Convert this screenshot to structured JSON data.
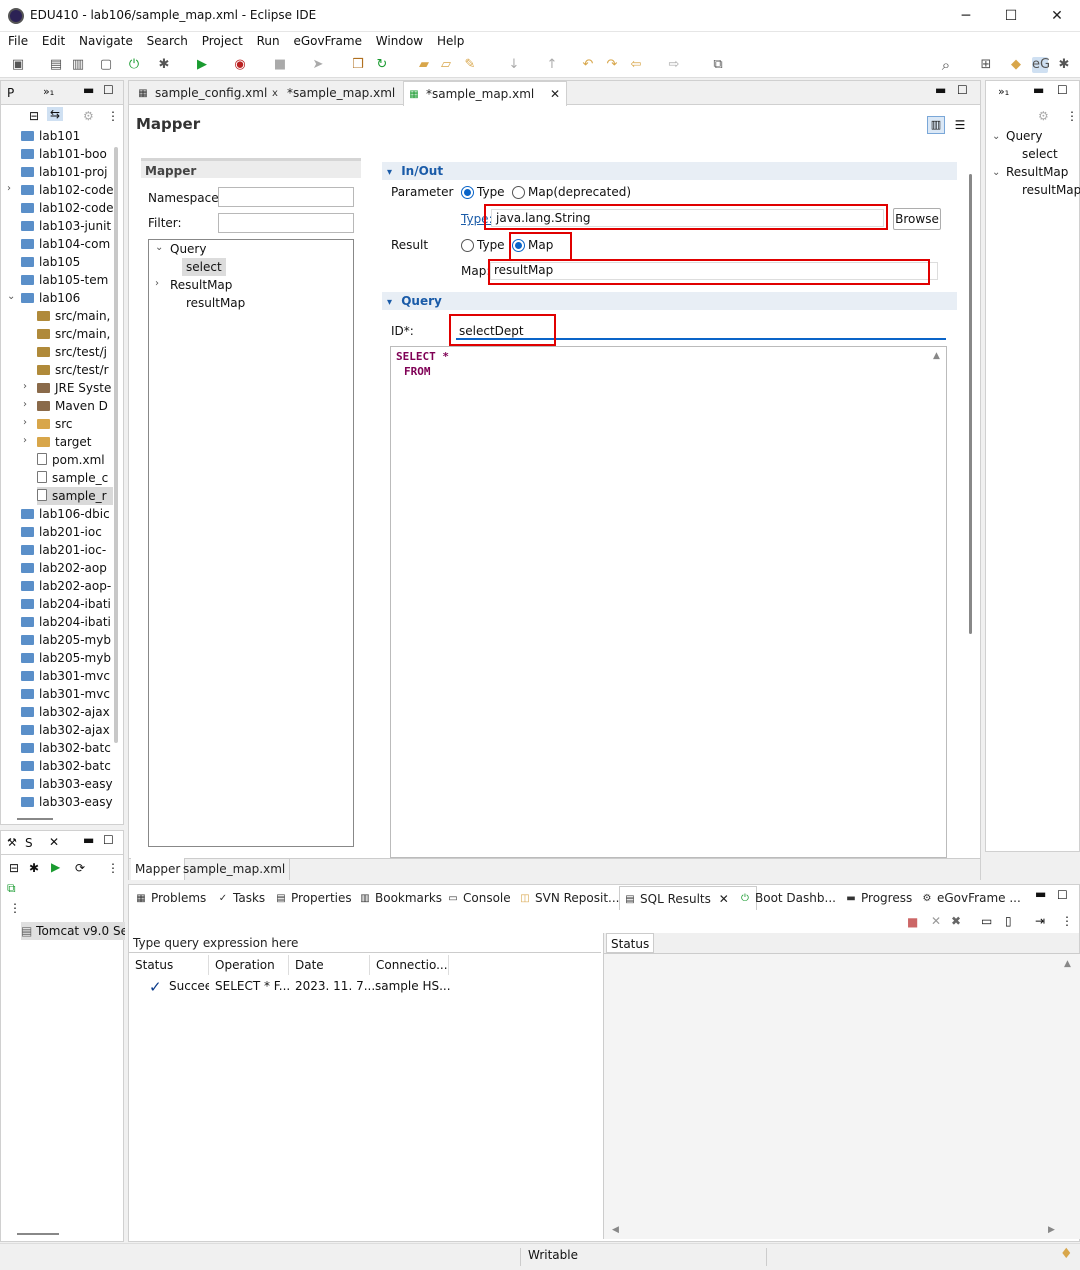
{
  "window": {
    "title": "EDU410 - lab106/sample_map.xml - Eclipse IDE",
    "minimize": "─",
    "maximize": "☐",
    "close": "✕"
  },
  "menu": [
    "File",
    "Edit",
    "Navigate",
    "Search",
    "Project",
    "Run",
    "eGovFrame",
    "Window",
    "Help"
  ],
  "left_panel": {
    "tab_label": "P",
    "overflow": "»₁",
    "items": [
      {
        "label": "lab101",
        "depth": 0,
        "icon": "folder"
      },
      {
        "label": "lab101-boo",
        "depth": 0,
        "icon": "folder"
      },
      {
        "label": "lab101-proj",
        "depth": 0,
        "icon": "folder"
      },
      {
        "label": "lab102-code",
        "depth": 0,
        "icon": "maven-folder",
        "expand": "›"
      },
      {
        "label": "lab102-code",
        "depth": 0,
        "icon": "folder"
      },
      {
        "label": "lab103-junit",
        "depth": 0,
        "icon": "folder"
      },
      {
        "label": "lab104-com",
        "depth": 0,
        "icon": "folder"
      },
      {
        "label": "lab105",
        "depth": 0,
        "icon": "folder"
      },
      {
        "label": "lab105-tem",
        "depth": 0,
        "icon": "folder"
      },
      {
        "label": "lab106",
        "depth": 0,
        "icon": "maven-folder",
        "expand": "⌄"
      },
      {
        "label": "src/main,",
        "depth": 1,
        "icon": "package"
      },
      {
        "label": "src/main,",
        "depth": 1,
        "icon": "package"
      },
      {
        "label": "src/test/j",
        "depth": 1,
        "icon": "package"
      },
      {
        "label": "src/test/r",
        "depth": 1,
        "icon": "package"
      },
      {
        "label": "JRE Syste",
        "depth": 1,
        "icon": "library",
        "expand": "›"
      },
      {
        "label": "Maven D",
        "depth": 1,
        "icon": "library",
        "expand": "›"
      },
      {
        "label": "src",
        "depth": 1,
        "icon": "yfolder",
        "expand": "›"
      },
      {
        "label": "target",
        "depth": 1,
        "icon": "yfolder",
        "expand": "›"
      },
      {
        "label": "pom.xml",
        "depth": 1,
        "icon": "file"
      },
      {
        "label": "sample_c",
        "depth": 1,
        "icon": "xml-file"
      },
      {
        "label": "sample_r",
        "depth": 1,
        "icon": "xml-file",
        "selected": true
      },
      {
        "label": "lab106-dbic",
        "depth": 0,
        "icon": "folder"
      },
      {
        "label": "lab201-ioc",
        "depth": 0,
        "icon": "folder"
      },
      {
        "label": "lab201-ioc-",
        "depth": 0,
        "icon": "folder"
      },
      {
        "label": "lab202-aop",
        "depth": 0,
        "icon": "folder"
      },
      {
        "label": "lab202-aop-",
        "depth": 0,
        "icon": "folder"
      },
      {
        "label": "lab204-ibati",
        "depth": 0,
        "icon": "folder"
      },
      {
        "label": "lab204-ibati",
        "depth": 0,
        "icon": "folder"
      },
      {
        "label": "lab205-myb",
        "depth": 0,
        "icon": "folder"
      },
      {
        "label": "lab205-myb",
        "depth": 0,
        "icon": "folder"
      },
      {
        "label": "lab301-mvc",
        "depth": 0,
        "icon": "folder"
      },
      {
        "label": "lab301-mvc",
        "depth": 0,
        "icon": "folder"
      },
      {
        "label": "lab302-ajax",
        "depth": 0,
        "icon": "folder"
      },
      {
        "label": "lab302-ajax",
        "depth": 0,
        "icon": "folder"
      },
      {
        "label": "lab302-batc",
        "depth": 0,
        "icon": "folder"
      },
      {
        "label": "lab302-batc",
        "depth": 0,
        "icon": "folder"
      },
      {
        "label": "lab303-easy",
        "depth": 0,
        "icon": "folder"
      },
      {
        "label": "lab303-easy",
        "depth": 0,
        "icon": "folder"
      }
    ]
  },
  "servers_panel": {
    "tab_label": "S",
    "server": "Tomcat v9.0 Se"
  },
  "editor": {
    "tabs": [
      {
        "label": "sample_config.xml",
        "active": false
      },
      {
        "label": "*sample_map.xml",
        "active": false
      },
      {
        "label": "*sample_map.xml",
        "active": true
      }
    ],
    "title": "Mapper",
    "mapper_section": "Mapper",
    "namespace_label": "Namespace:",
    "filter_label": "Filter:",
    "tree": [
      {
        "label": "Query",
        "depth": 0,
        "expand": "⌄"
      },
      {
        "label": "select",
        "depth": 1,
        "selected": true
      },
      {
        "label": "ResultMap",
        "depth": 0,
        "expand": "›"
      },
      {
        "label": "resultMap",
        "depth": 1
      }
    ],
    "inout_header": "In/Out",
    "parameter_label": "Parameter",
    "param_type_option": "Type",
    "param_map_option": "Map(deprecated)",
    "type_link": "Type:",
    "type_value": "java.lang.String",
    "browse_label": "Browse",
    "result_label": "Result",
    "result_type_option": "Type",
    "result_map_option": "Map",
    "map_label": "Map:",
    "map_value": "resultMap",
    "query_header": "Query",
    "id_label": "ID*:",
    "id_value": "selectDept",
    "sql_line1": "SELECT *",
    "sql_line2": "FROM",
    "bottom_tabs": [
      "Mapper",
      "sample_map.xml"
    ]
  },
  "outline": {
    "overflow": "»₁",
    "tree": [
      {
        "label": "Query",
        "depth": 0,
        "expand": "⌄"
      },
      {
        "label": "select",
        "depth": 1
      },
      {
        "label": "ResultMap",
        "depth": 0,
        "expand": "⌄"
      },
      {
        "label": "resultMap",
        "depth": 1
      }
    ]
  },
  "bottom_panel": {
    "tabs": [
      "Problems",
      "Tasks",
      "Properties",
      "Bookmarks",
      "Console",
      "SVN Reposit...",
      "SQL Results",
      "Boot Dashb...",
      "Progress",
      "eGovFrame ..."
    ],
    "active_tab": "SQL Results",
    "query_placeholder": "Type query expression here",
    "columns": [
      "Status",
      "Operation",
      "Date",
      "Connectio..."
    ],
    "row": {
      "status": "Succeeded",
      "operation": "SELECT * F...",
      "date": "2023. 11. 7...",
      "connection": "sample HS..."
    },
    "status_tab": "Status"
  },
  "statusbar": {
    "text": "Writable"
  },
  "colors": {
    "highlight_red": "#e00000",
    "link_blue": "#1a5ba8",
    "sql_keyword": "#7f0055"
  }
}
